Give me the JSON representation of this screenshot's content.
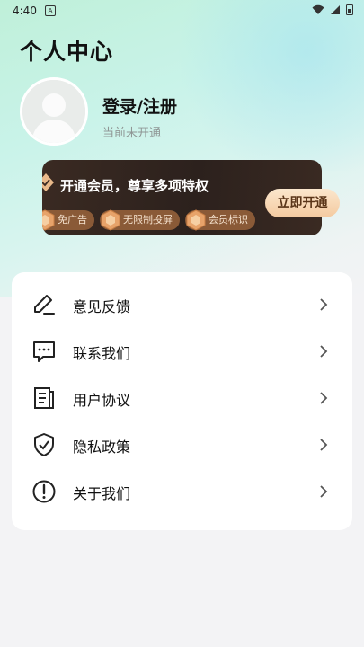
{
  "status_bar": {
    "time": "4:40",
    "notification_letter": "A"
  },
  "header": {
    "title": "个人中心"
  },
  "profile": {
    "login_label": "登录/注册",
    "member_status": "当前未开通"
  },
  "vip": {
    "title": "开通会员，尊享多项特权",
    "perks": [
      "免广告",
      "无限制投屏",
      "会员标识"
    ],
    "open_button_label": "立即开通"
  },
  "menu": {
    "items": [
      {
        "label": "意见反馈",
        "icon": "edit-pen-icon"
      },
      {
        "label": "联系我们",
        "icon": "chat-icon"
      },
      {
        "label": "用户协议",
        "icon": "document-icon"
      },
      {
        "label": "隐私政策",
        "icon": "shield-check-icon"
      },
      {
        "label": "关于我们",
        "icon": "info-circle-icon"
      }
    ]
  },
  "colors": {
    "vip_card_bg": "#2c211d",
    "vip_perk_bg": "#8a5a37",
    "open_button_bg": "#f4caa0",
    "hero_gradient_start": "#bff0d9"
  }
}
